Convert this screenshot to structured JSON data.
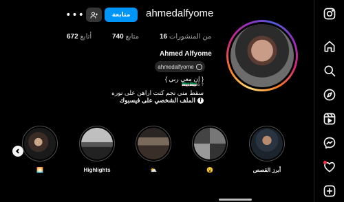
{
  "profile": {
    "username": "ahmedalfyome",
    "full_name": "Ahmed Alfyome",
    "threads_handle": "ahmedalfyome",
    "follow_label": "متابعة",
    "more_label": "•••"
  },
  "stats": {
    "posts_count": "16",
    "posts_label": "من المنشورات",
    "followers_count": "740",
    "followers_label": "متابع",
    "following_count": "672",
    "following_label": "أتابع"
  },
  "bio": {
    "line1": "{ إن معي ربي }",
    "line2": "🇸🇾🇸🇾⁸ ⁷",
    "line3": "سقط مني نجم كنت اراهن على نوره",
    "facebook_link": "الملف الشخصي على فيسبوك"
  },
  "highlights": [
    {
      "label": "🌅"
    },
    {
      "label": "Highlights"
    },
    {
      "label": "⛅"
    },
    {
      "label": "😮"
    },
    {
      "label": "أبرز القصص"
    }
  ],
  "colors": {
    "accent": "#0095f6",
    "background": "#000000",
    "notification": "#ff3040"
  },
  "sidebar_icons": [
    "instagram-logo-icon",
    "home-icon",
    "search-icon",
    "explore-icon",
    "reels-icon",
    "messenger-icon",
    "notifications-heart-icon",
    "create-plus-icon"
  ]
}
